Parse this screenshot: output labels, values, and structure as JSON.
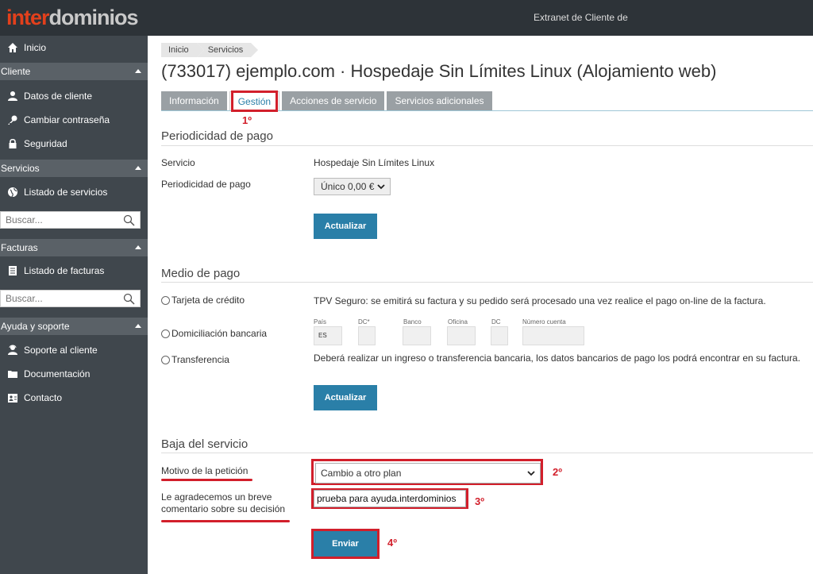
{
  "brand": {
    "logo_part1": "inter",
    "logo_part2": "dominios",
    "header_text": "Extranet de Cliente de"
  },
  "sidebar": {
    "inicio": "Inicio",
    "sections": {
      "cliente": "Cliente",
      "servicios": "Servicios",
      "facturas": "Facturas",
      "ayuda": "Ayuda y soporte"
    },
    "items": {
      "datos_cliente": "Datos de cliente",
      "cambiar_contrasena": "Cambiar contraseña",
      "seguridad": "Seguridad",
      "listado_servicios": "Listado de servicios",
      "listado_facturas": "Listado de facturas",
      "soporte": "Soporte al cliente",
      "documentacion": "Documentación",
      "contacto": "Contacto"
    },
    "search_placeholder": "Buscar..."
  },
  "breadcrumb": [
    "Inicio",
    "Servicios"
  ],
  "page_title": "(733017) ejemplo.com · Hospedaje Sin Límites Linux (Alojamiento web)",
  "tabs": [
    "Información",
    "Gestión",
    "Acciones de servicio",
    "Servicios adicionales"
  ],
  "active_tab": "Gestión",
  "annotations": {
    "step1": "1º",
    "step2": "2º",
    "step3": "3º",
    "step4": "4º"
  },
  "periodicidad": {
    "title": "Periodicidad de pago",
    "servicio_label": "Servicio",
    "servicio_value": "Hospedaje Sin Límites Linux",
    "periodicidad_label": "Periodicidad de pago",
    "periodicidad_value": "Único 0,00 €",
    "update_button": "Actualizar"
  },
  "medio_pago": {
    "title": "Medio de pago",
    "options": {
      "tarjeta": "Tarjeta de crédito",
      "domiciliacion": "Domiciliación bancaria",
      "transferencia": "Transferencia"
    },
    "tarjeta_text": "TPV Seguro: se emitirá su factura y su pedido será procesado una vez realice el pago on-line de la factura.",
    "bank_labels": {
      "pais": "País",
      "dc_star": "DC*",
      "banco": "Banco",
      "oficina": "Oficina",
      "dc": "DC",
      "numero_cuenta": "Número cuenta"
    },
    "bank_values": {
      "pais": "ES"
    },
    "transferencia_text": "Deberá realizar un ingreso o transferencia bancaria, los datos bancarios de pago los podrá encontrar en su factura.",
    "update_button": "Actualizar"
  },
  "baja": {
    "title": "Baja del servicio",
    "motivo_label": "Motivo de la petición",
    "motivo_value": "Cambio a otro plan",
    "comentario_label_line1": "Le agradecemos un breve",
    "comentario_label_line2": "comentario sobre su decisión",
    "comentario_value": "prueba para ayuda.interdominios",
    "submit_button": "Enviar"
  },
  "colors": {
    "accent": "#2a7fa8",
    "highlight": "#d21f2b",
    "sidebar": "#40474d",
    "topbar": "#2d3338"
  }
}
